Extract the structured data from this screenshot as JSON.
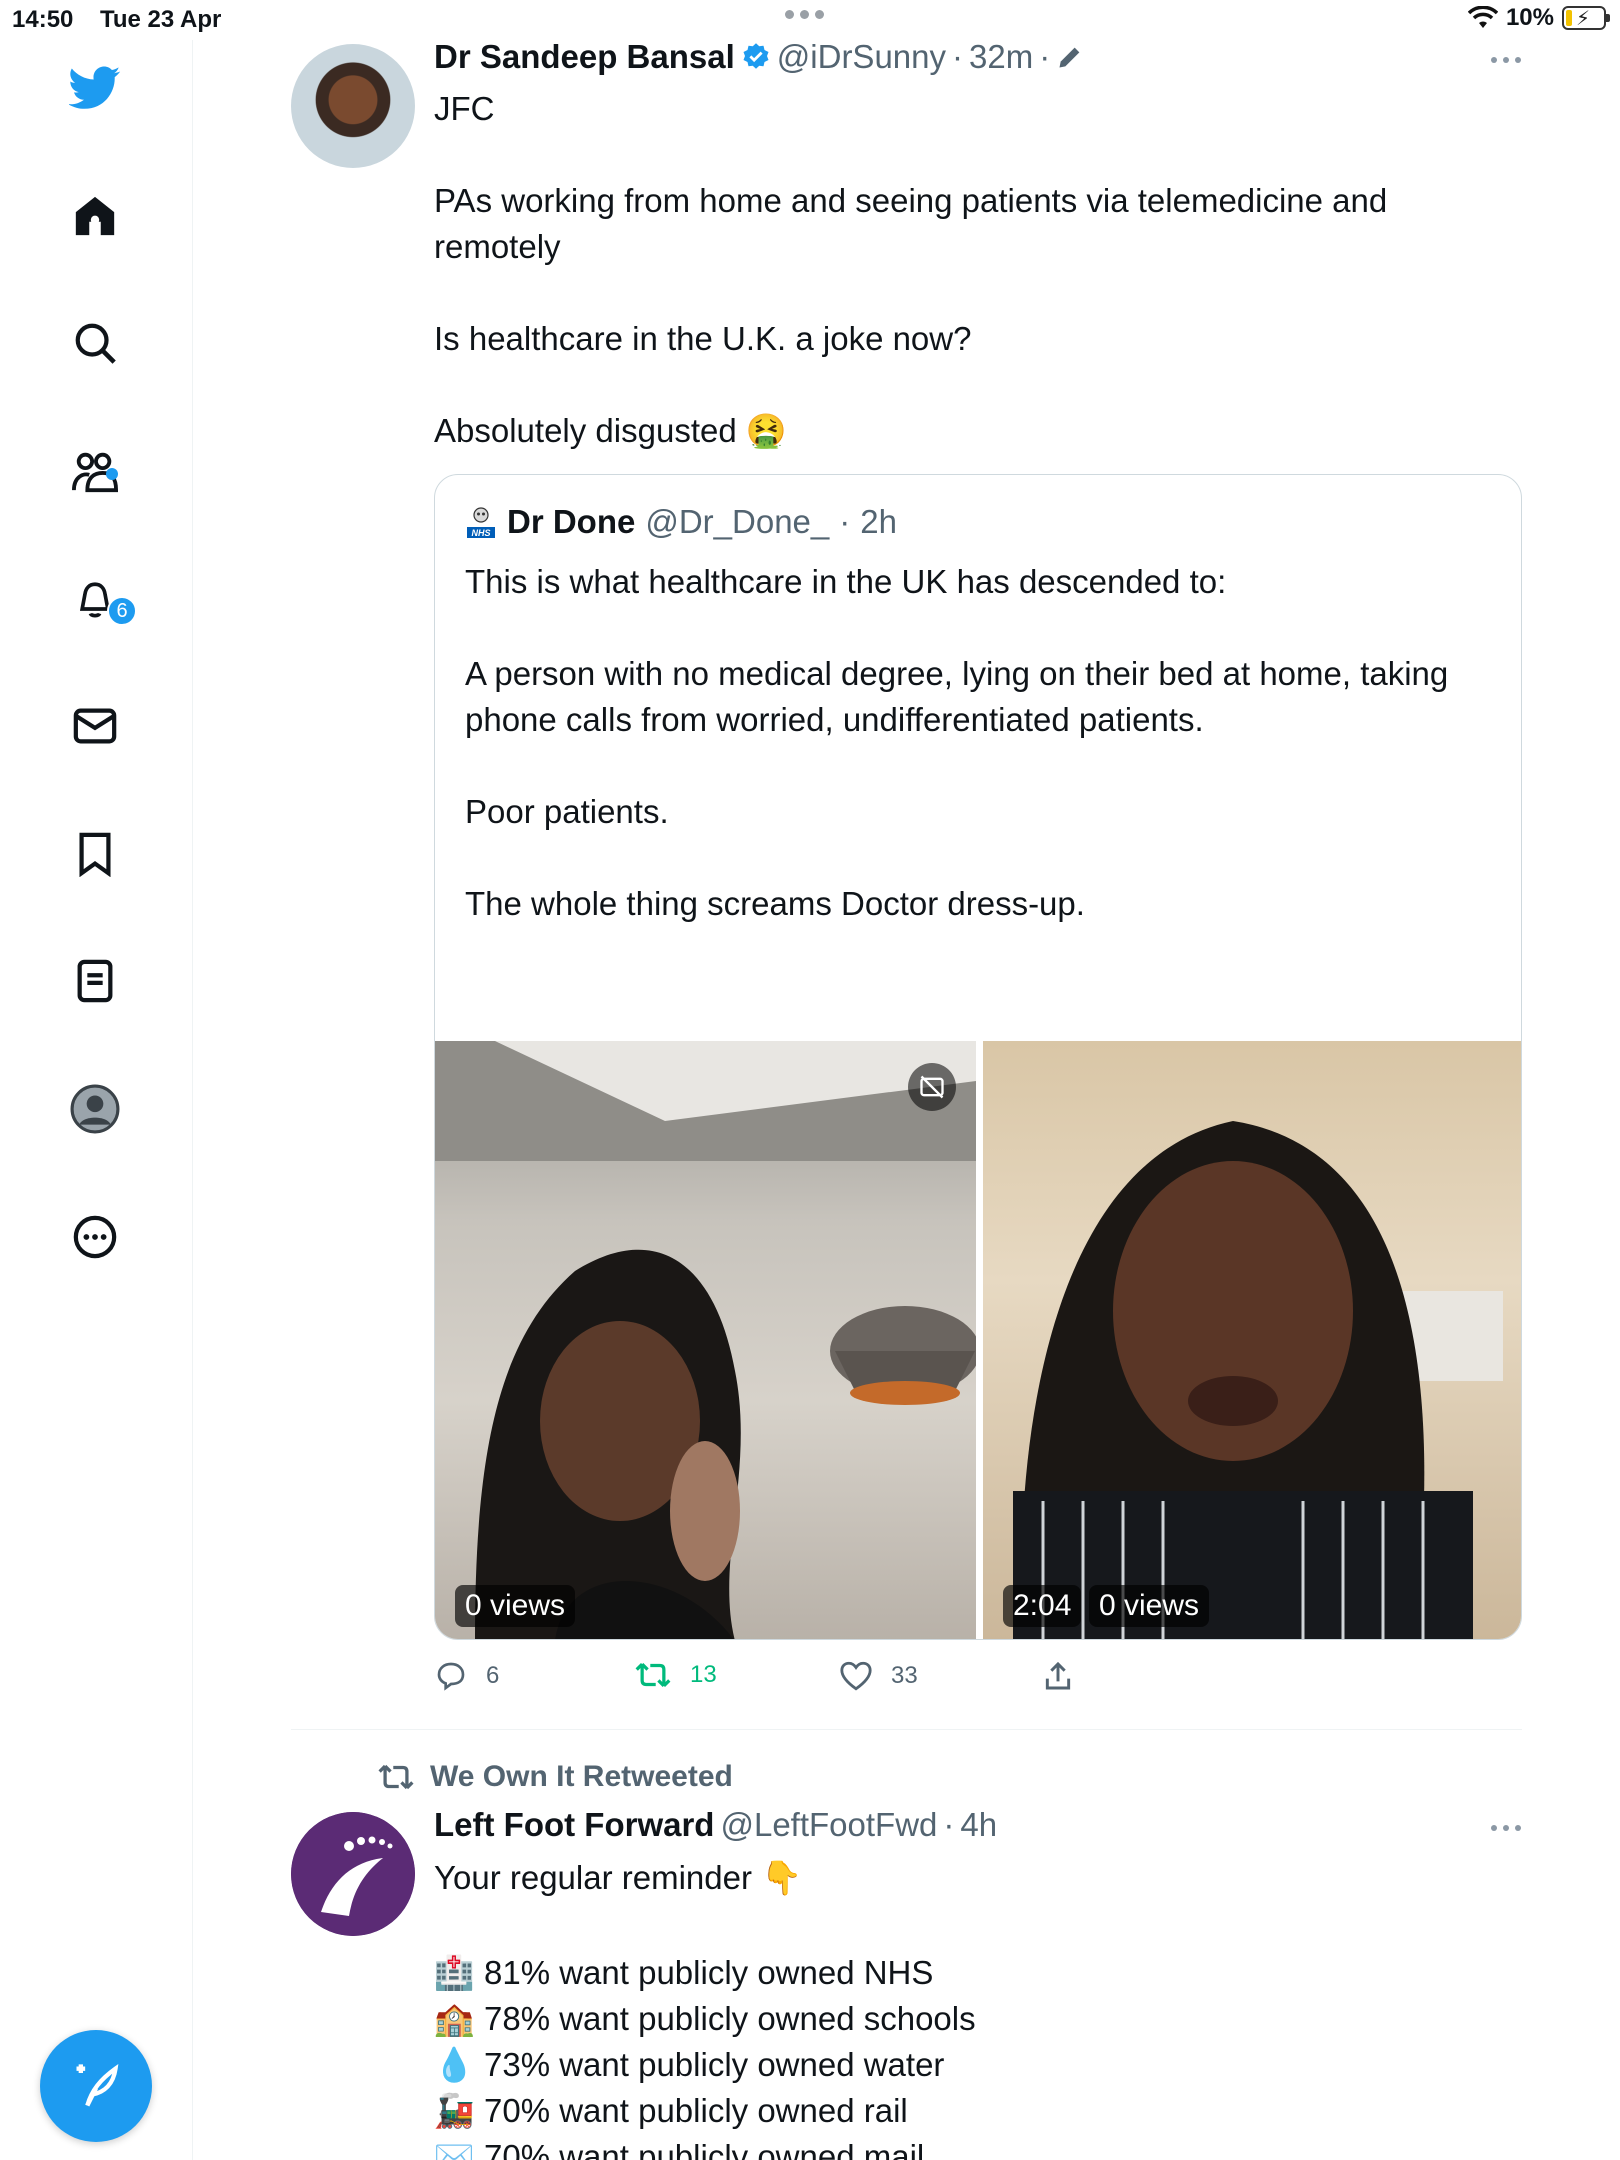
{
  "status_bar": {
    "time": "14:50",
    "date": "Tue 23 Apr",
    "battery": "10%"
  },
  "sidebar": {
    "items": [
      {
        "name": "home"
      },
      {
        "name": "explore"
      },
      {
        "name": "communities"
      },
      {
        "name": "notifications",
        "badge": "6"
      },
      {
        "name": "messages"
      },
      {
        "name": "bookmarks"
      },
      {
        "name": "lists"
      },
      {
        "name": "profile"
      },
      {
        "name": "more"
      }
    ]
  },
  "tweet1": {
    "name": "Dr Sandeep Bansal",
    "handle": "@iDrSunny",
    "sep": "·",
    "time": "32m",
    "sep2": "·",
    "text": "JFC\n\nPAs working from home and seeing patients via telemedicine and\nremotely\n\nIs healthcare in the U.K. a joke now?\n\nAbsolutely disgusted 🤮",
    "quote": {
      "name": "Dr Done",
      "handle": "@Dr_Done_",
      "sep": "·",
      "time": "2h",
      "text": "This is what healthcare in the UK has descended to:\n\nA person with no medical degree, lying on their bed at home, taking\nphone calls from worried, undifferentiated patients.\n\nPoor patients.\n\nThe whole thing screams Doctor dress-up.",
      "xmarks": "❌❌❌",
      "media": [
        {
          "views": "0 views"
        },
        {
          "duration": "2:04",
          "views": "0 views"
        }
      ]
    },
    "actions": {
      "replies": "6",
      "retweets": "13",
      "likes": "33"
    }
  },
  "tweet2": {
    "retweeted_by": "We Own It Retweeted",
    "name": "Left Foot Forward",
    "handle": "@LeftFootFwd",
    "sep": "·",
    "time": "4h",
    "text": "Your regular reminder 👇",
    "list": [
      {
        "icon": "🏥",
        "text": "81% want publicly owned NHS"
      },
      {
        "icon": "🏫",
        "text": "78% want publicly owned schools"
      },
      {
        "icon": "💧",
        "text": "73% want publicly owned water"
      },
      {
        "icon": "🚂",
        "text": "70% want publicly owned rail"
      },
      {
        "icon": "✉️",
        "text": "70% want publicly owned mail"
      }
    ]
  },
  "colors": {
    "accent": "#1d9bf0",
    "retweet_green": "#00ba7c",
    "muted": "#536471"
  }
}
